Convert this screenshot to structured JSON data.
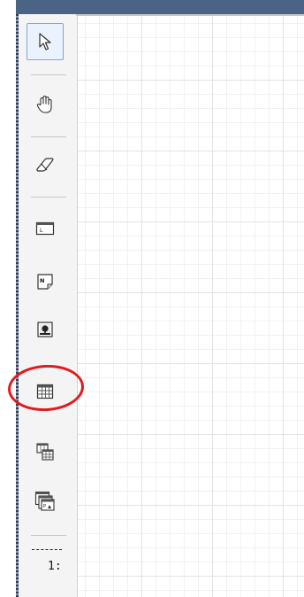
{
  "toolbar": {
    "tools": [
      {
        "name": "select-tool",
        "icon": "arrow-pointer-icon",
        "selected": true
      },
      {
        "name": "pan-tool",
        "icon": "hand-icon",
        "selected": false
      },
      {
        "name": "eraser-tool",
        "icon": "eraser-icon",
        "selected": false
      },
      {
        "name": "label-frame-tool",
        "icon": "label-frame-icon",
        "selected": false
      },
      {
        "name": "note-tool",
        "icon": "note-icon",
        "selected": false
      },
      {
        "name": "image-tool",
        "icon": "image-icon",
        "selected": false
      },
      {
        "name": "table-tool",
        "icon": "table-icon",
        "selected": false,
        "annotated": true
      },
      {
        "name": "stacked-tables-tool",
        "icon": "stacked-tables-icon",
        "selected": false
      },
      {
        "name": "stacked-images-tool",
        "icon": "stacked-images-icon",
        "selected": false
      }
    ],
    "scale_label": "1:"
  },
  "colors": {
    "title_bar": "#4b6385",
    "selection_border": "#7aa7df",
    "annotation_red": "#e4191b",
    "grid_line": "#e3e3e3"
  }
}
